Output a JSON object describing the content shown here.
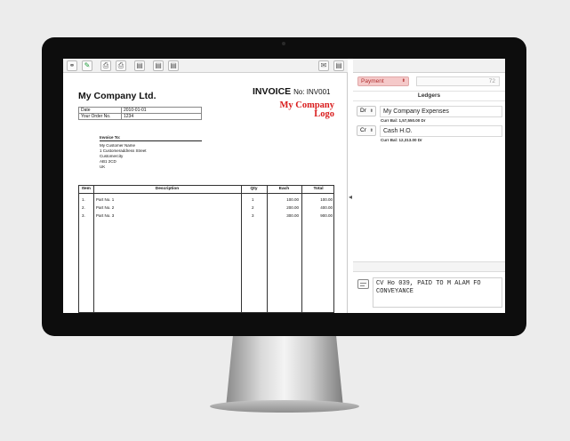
{
  "colors": {
    "logo_red": "#d91c1c",
    "payment_bg": "#f5c9c9",
    "pin_green": "#1d9a3a"
  },
  "toolbar": {
    "left_icons": [
      "link-icon",
      "pin-icon",
      "print-icon",
      "print-preview-icon",
      "export-icon",
      "save-icon",
      "copy-icon"
    ],
    "right_icons": [
      "mail-icon",
      "attach-icon"
    ]
  },
  "invoice": {
    "company_name": "My Company Ltd.",
    "title": "INVOICE",
    "number_label": "No: INV001",
    "logo_line1": "My Company",
    "logo_line2": "Logo",
    "date_label": "Date",
    "date_value": "2010-01-01",
    "order_label": "Your Order No.",
    "order_value": "1234",
    "bill_to_label": "Invoice To:",
    "bill_to_lines": [
      "My Customer Name",
      "1 Customeraddress Street",
      "Customercity",
      "AB1 2CD",
      "UK"
    ],
    "columns": [
      "Item",
      "Description",
      "Qty",
      "Each",
      "Total"
    ],
    "rows": [
      {
        "item": "1.",
        "description": "Part No. 1",
        "qty": "1",
        "each": "100.00",
        "total": "100.00"
      },
      {
        "item": "2.",
        "description": "Part No. 2",
        "qty": "2",
        "each": "200.00",
        "total": "400.00"
      },
      {
        "item": "3.",
        "description": "Part No. 3",
        "qty": "3",
        "each": "300.00",
        "total": "900.00"
      }
    ]
  },
  "voucher": {
    "type": "Payment",
    "number": "72",
    "ledgers_header": "Ledgers",
    "ledgers": [
      {
        "drcr": "Dr",
        "name": "My Company Expenses",
        "balance": "Curr Bal: 1,57,550.00 Dr"
      },
      {
        "drcr": "Cr",
        "name": "Cash H.O.",
        "balance": "Curr Bal: 12,313.00 Dr"
      }
    ],
    "narration": "CV Ho 039, PAID TO M ALAM FO CONVEYANCE"
  }
}
